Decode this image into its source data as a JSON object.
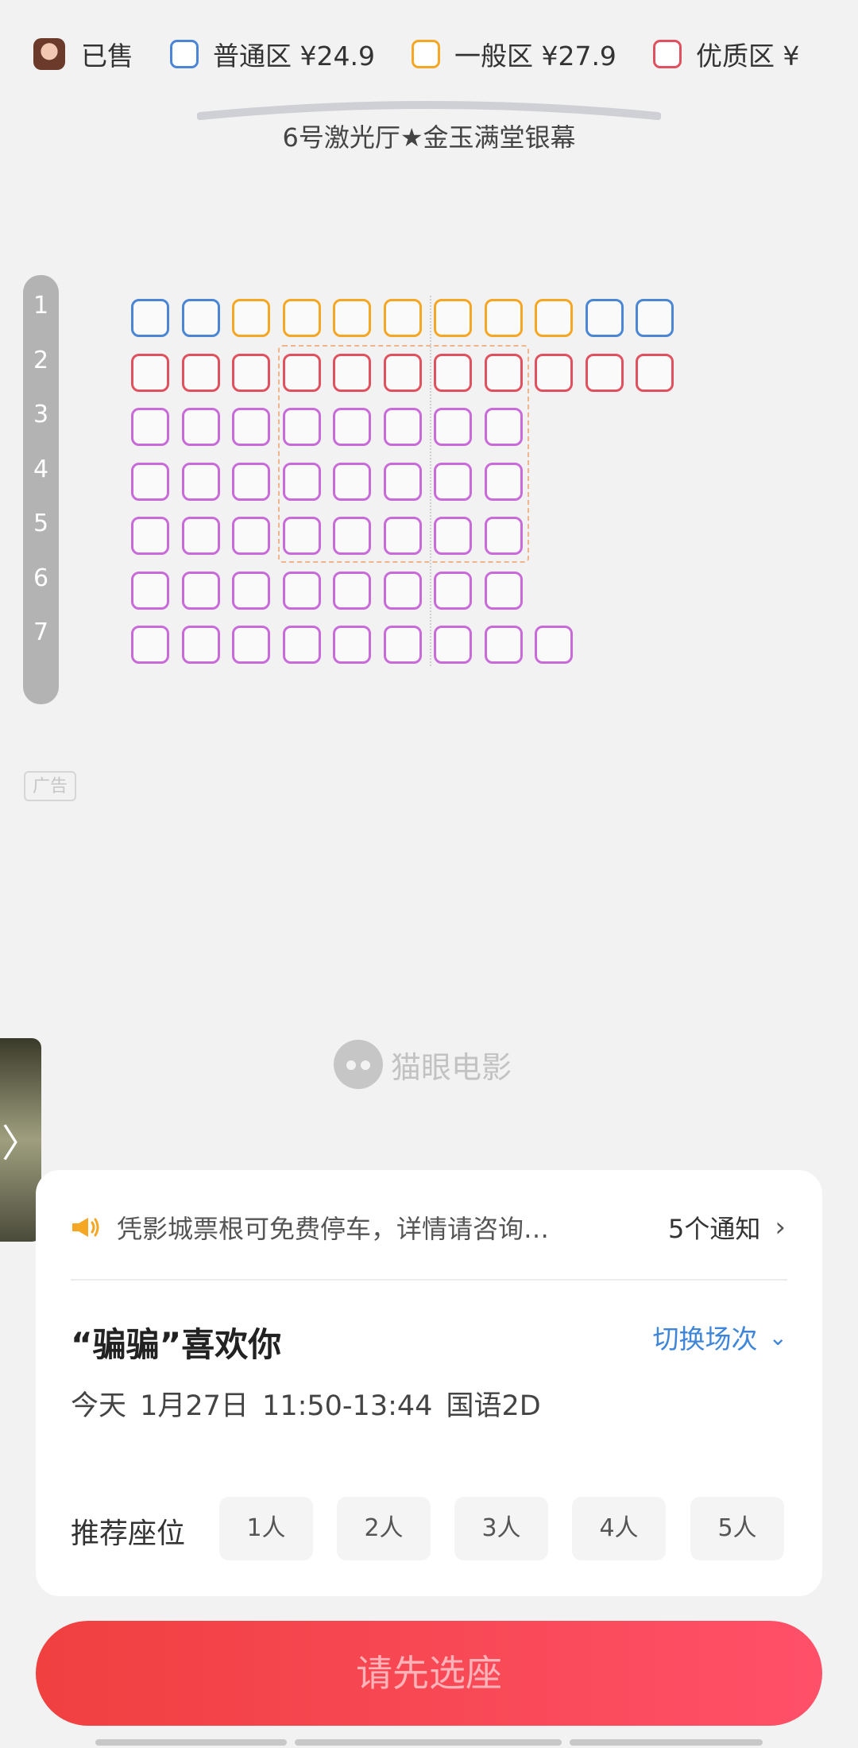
{
  "legend": {
    "sold": {
      "label": "已售"
    },
    "zones": [
      {
        "label": "普通区 ¥24.9",
        "color": "#4a86d4"
      },
      {
        "label": "一般区 ¥27.9",
        "color": "#f5a623"
      },
      {
        "label": "优质区 ¥",
        "color": "#e0515f"
      }
    ]
  },
  "screen": {
    "hall_name": "6号激光厅★金玉满堂银幕"
  },
  "rows": [
    "1",
    "2",
    "3",
    "4",
    "5",
    "6",
    "7"
  ],
  "seat_map": [
    [
      "blue",
      "blue",
      "orange",
      "orange",
      "orange",
      "orange",
      "orange",
      "orange",
      "orange",
      "blue",
      "blue"
    ],
    [
      "red",
      "red",
      "red",
      "red",
      "red",
      "red",
      "red",
      "red",
      "red",
      "red",
      "red"
    ],
    [
      "purple",
      "purple",
      "purple",
      "purple",
      "purple",
      "purple",
      "purple",
      "purple"
    ],
    [
      "purple",
      "purple",
      "purple",
      "purple",
      "purple",
      "purple",
      "purple",
      "purple"
    ],
    [
      "purple",
      "purple",
      "purple",
      "purple",
      "purple",
      "purple",
      "purple",
      "purple"
    ],
    [
      "purple",
      "purple",
      "purple",
      "purple",
      "purple",
      "purple",
      "purple",
      "purple"
    ],
    [
      "purple",
      "purple",
      "purple",
      "purple",
      "purple",
      "purple",
      "purple",
      "purple",
      "purple"
    ]
  ],
  "seat_colors": {
    "blue": "#4a86d4",
    "orange": "#f5a623",
    "red": "#e0515f",
    "purple": "#c86bd9"
  },
  "ad_tag": "广告",
  "watermark": "猫眼电影",
  "side_tab": {
    "icon": "chevron-right-icon",
    "glyph": "〉"
  },
  "notice": {
    "text": "凭影城票根可免费停车，详情请咨询…",
    "count": "5个通知",
    "chevron": "›"
  },
  "movie": {
    "title": "“骗骗”喜欢你",
    "switch_label": "切换场次",
    "switch_chevron": "⌄",
    "session": "今天  1月27日  11:50-13:44  国语2D"
  },
  "recommend": {
    "label": "推荐座位",
    "options": [
      "1人",
      "2人",
      "3人",
      "4人",
      "5人"
    ]
  },
  "cta": {
    "label": "请先选座"
  }
}
